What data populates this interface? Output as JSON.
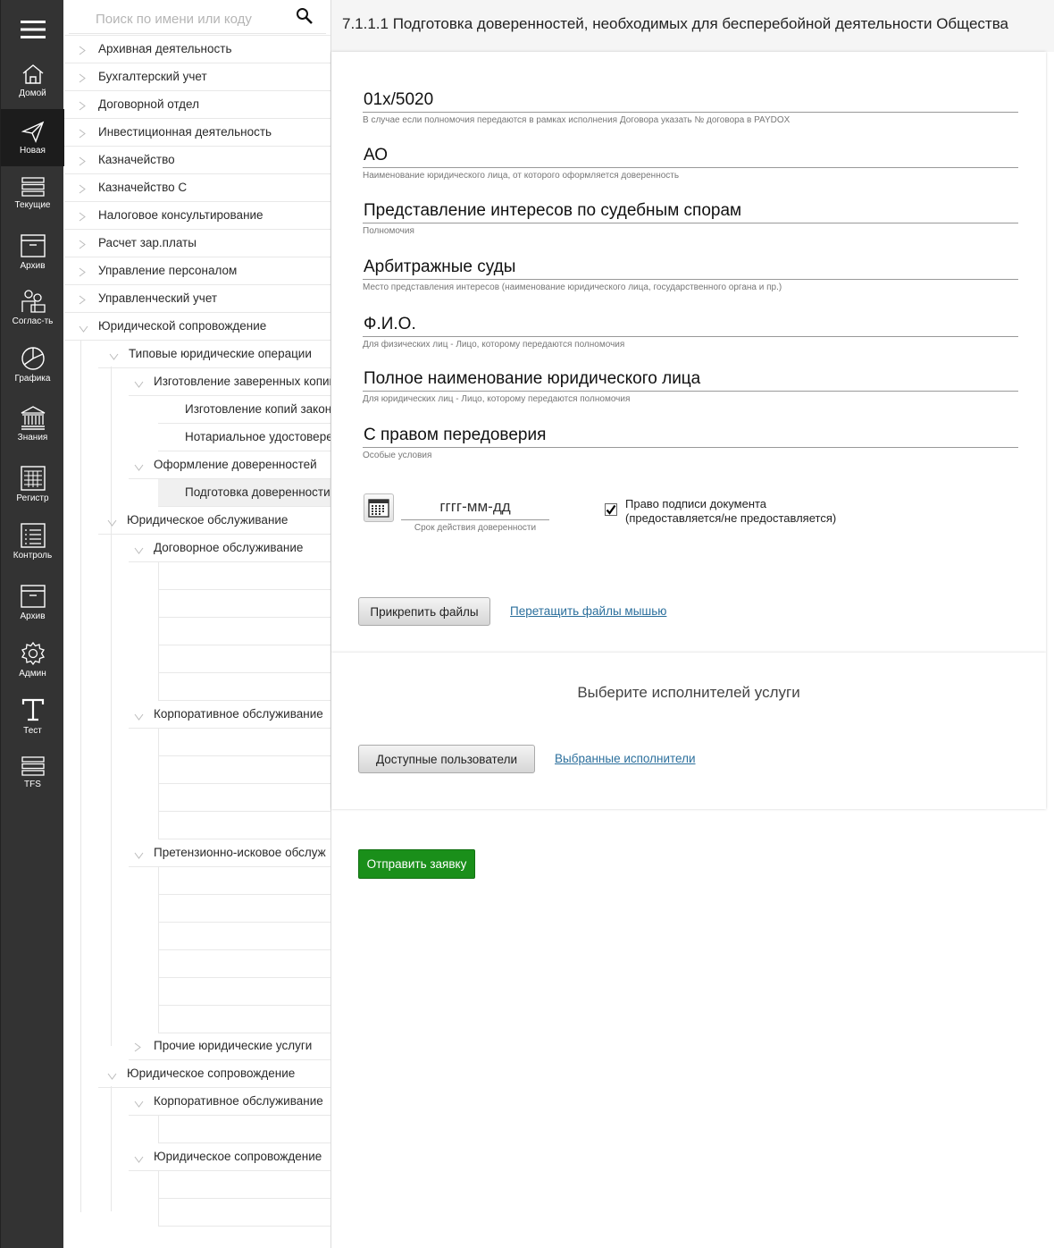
{
  "rail": {
    "items": [
      {
        "label": "Домой",
        "icon": "home-icon"
      },
      {
        "label": "Новая",
        "icon": "send-icon"
      },
      {
        "label": "Текущие",
        "icon": "stack-icon"
      },
      {
        "label": "Архив",
        "icon": "archive-icon"
      },
      {
        "label": "Соглас-ть",
        "icon": "users-icon"
      },
      {
        "label": "Графика",
        "icon": "pie-chart-icon"
      },
      {
        "label": "Знания",
        "icon": "bank-icon"
      },
      {
        "label": "Регистр",
        "icon": "grid-icon"
      },
      {
        "label": "Контроль",
        "icon": "list-icon"
      },
      {
        "label": "Архив",
        "icon": "archive-icon"
      },
      {
        "label": "Админ",
        "icon": "gear-icon"
      },
      {
        "label": "Тест",
        "icon": "text-t-icon"
      },
      {
        "label": "TFS",
        "icon": "stack-icon"
      }
    ]
  },
  "search": {
    "placeholder": "Поиск по имени или коду"
  },
  "tree": {
    "nodes": [
      "Архивная деятельность",
      "Бухгалтерский учет",
      "Договорной отдел",
      "Инвестиционная деятельность",
      "Казначейство",
      "Казначейство С",
      "Налоговое консультирование",
      "Расчет зар.платы",
      "Управление персоналом",
      "Управленческий учет",
      "Юридической сопровождение",
      "Типовые юридические операции",
      "Изготовление заверенных копий",
      "Изготовление копий закон",
      "Нотариальное удостоверен",
      "Оформление доверенностей",
      "Подготовка доверенности",
      "Юридическое обслуживание",
      "Договорное обслуживание",
      "Корпоративное обслуживание",
      "Претензионно-исковое обслуж",
      "Прочие юридические услуги",
      "Юридическое сопровождение",
      "Корпоративное обслуживание",
      "Юридическое сопровождение"
    ]
  },
  "header": {
    "title": "7.1.1.1 Подготовка доверенностей, необходимых для бесперебойной деятельности Общества"
  },
  "form": {
    "fields": [
      {
        "value": "01х/5020",
        "hint": "В случае если полномочия передаются в рамках исполнения Договора указать № договора в PAYDOX"
      },
      {
        "value": "АО",
        "hint": "Наименование юридического лица, от которого оформляется доверенность"
      },
      {
        "value": "Представление интересов по судебным спорам",
        "hint": "Полномочия"
      },
      {
        "value": "Арбитражные суды",
        "hint": "Место представления интересов (наименование юридического лица, государственного органа и пр.)"
      },
      {
        "value": "Ф.И.О.",
        "hint": "Для физических лиц - Лицо, которому передаются полномочия"
      },
      {
        "value": "Полное наименование юридического лица",
        "hint": "Для юридических лиц - Лицо, которому передаются полномочия"
      },
      {
        "value": "С правом передоверия",
        "hint": "Особые условия"
      }
    ],
    "date": {
      "placeholder": "гггг-мм-дд",
      "hint": "Срок действия доверенности"
    },
    "checkbox": {
      "label_line1": "Право подписи документа",
      "label_line2": "(предоставляется/не предоставляется)",
      "checked": true
    },
    "attach_button": "Прикрепить файлы",
    "drag_link": "Перетащить файлы мышью"
  },
  "executors": {
    "title": "Выберите исполнителей услуги",
    "available_button": "Доступные пользователи",
    "selected_link": "Выбранные исполнители"
  },
  "submit": {
    "label": "Отправить заявку"
  },
  "colors": {
    "rail": "#333333",
    "submit": "#1a8f1a",
    "link": "#2b6f9c"
  }
}
